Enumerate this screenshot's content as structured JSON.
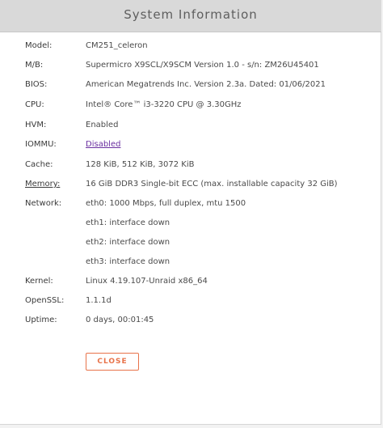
{
  "dialog": {
    "title": "System Information",
    "close_label": "CLOSE"
  },
  "info": {
    "model": {
      "label": "Model:",
      "value": "CM251_celeron"
    },
    "mb": {
      "label": "M/B:",
      "value": "Supermicro X9SCL/X9SCM Version 1.0 - s/n: ZM26U45401"
    },
    "bios": {
      "label": "BIOS:",
      "value": "American Megatrends Inc. Version 2.3a. Dated: 01/06/2021"
    },
    "cpu": {
      "label": "CPU:",
      "value": "Intel® Core™ i3-3220 CPU @ 3.30GHz"
    },
    "hvm": {
      "label": "HVM:",
      "value": "Enabled"
    },
    "iommu": {
      "label": "IOMMU:",
      "value": "Disabled"
    },
    "cache": {
      "label": "Cache:",
      "value": "128 KiB, 512 KiB, 3072 KiB"
    },
    "memory": {
      "label": "Memory:",
      "value": "16 GiB DDR3 Single-bit ECC (max. installable capacity 32 GiB)"
    },
    "network": {
      "label": "Network:",
      "values": [
        "eth0: 1000 Mbps, full duplex, mtu 1500",
        "eth1: interface down",
        "eth2: interface down",
        "eth3: interface down"
      ]
    },
    "kernel": {
      "label": "Kernel:",
      "value": "Linux 4.19.107-Unraid x86_64"
    },
    "openssl": {
      "label": "OpenSSL:",
      "value": "1.1.1d"
    },
    "uptime": {
      "label": "Uptime:",
      "value": "0 days, 00:01:45"
    }
  }
}
